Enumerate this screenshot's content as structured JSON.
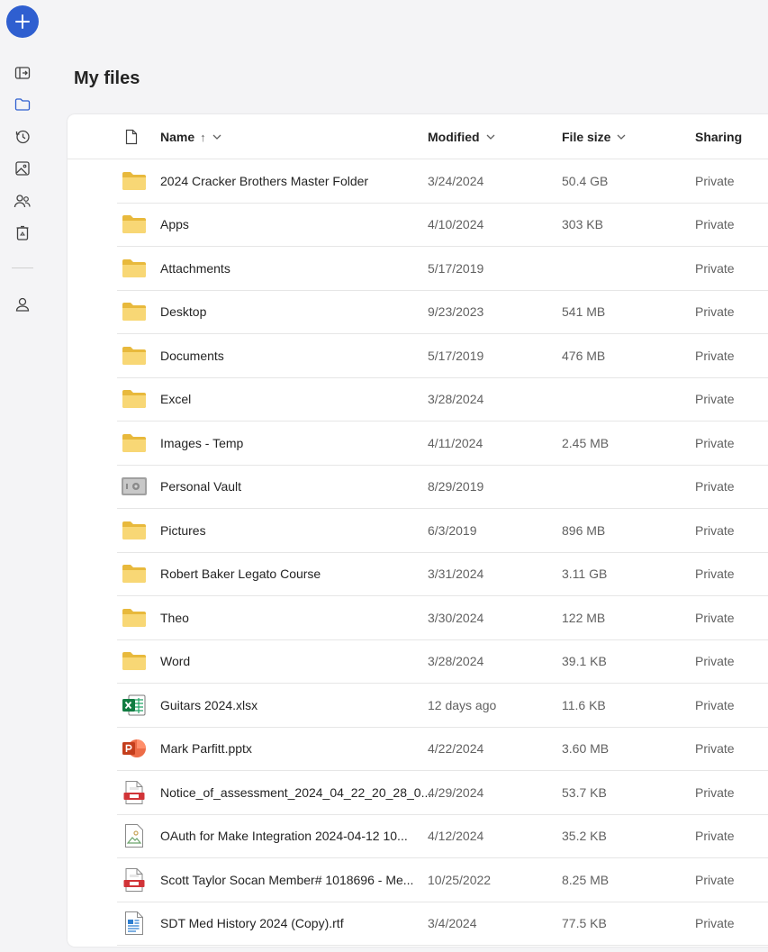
{
  "page": {
    "title": "My files"
  },
  "rail": {
    "new_label": "+",
    "icons": [
      "sidebar-toggle-icon",
      "folder-icon",
      "recent-icon",
      "photos-icon",
      "shared-icon",
      "recycle-bin-icon",
      "account-icon"
    ]
  },
  "columns": {
    "name": "Name",
    "sort_arrow": "↑",
    "modified": "Modified",
    "size": "File size",
    "sharing": "Sharing"
  },
  "files": [
    {
      "icon": "folder",
      "name": "2024 Cracker Brothers Master Folder",
      "modified": "3/24/2024",
      "size": "50.4 GB",
      "sharing": "Private"
    },
    {
      "icon": "folder",
      "name": "Apps",
      "modified": "4/10/2024",
      "size": "303 KB",
      "sharing": "Private"
    },
    {
      "icon": "folder",
      "name": "Attachments",
      "modified": "5/17/2019",
      "size": "",
      "sharing": "Private"
    },
    {
      "icon": "folder",
      "name": "Desktop",
      "modified": "9/23/2023",
      "size": "541 MB",
      "sharing": "Private"
    },
    {
      "icon": "folder",
      "name": "Documents",
      "modified": "5/17/2019",
      "size": "476 MB",
      "sharing": "Private"
    },
    {
      "icon": "folder",
      "name": "Excel",
      "modified": "3/28/2024",
      "size": "",
      "sharing": "Private"
    },
    {
      "icon": "folder",
      "name": "Images - Temp",
      "modified": "4/11/2024",
      "size": "2.45 MB",
      "sharing": "Private"
    },
    {
      "icon": "vault",
      "name": "Personal Vault",
      "modified": "8/29/2019",
      "size": "",
      "sharing": "Private"
    },
    {
      "icon": "folder",
      "name": "Pictures",
      "modified": "6/3/2019",
      "size": "896 MB",
      "sharing": "Private"
    },
    {
      "icon": "folder",
      "name": "Robert Baker Legato Course",
      "modified": "3/31/2024",
      "size": "3.11 GB",
      "sharing": "Private"
    },
    {
      "icon": "folder",
      "name": "Theo",
      "modified": "3/30/2024",
      "size": "122 MB",
      "sharing": "Private"
    },
    {
      "icon": "folder",
      "name": "Word",
      "modified": "3/28/2024",
      "size": "39.1 KB",
      "sharing": "Private"
    },
    {
      "icon": "excel",
      "name": "Guitars 2024.xlsx",
      "modified": "12 days ago",
      "size": "11.6 KB",
      "sharing": "Private"
    },
    {
      "icon": "powerpoint",
      "name": "Mark Parfitt.pptx",
      "modified": "4/22/2024",
      "size": "3.60 MB",
      "sharing": "Private"
    },
    {
      "icon": "pdf",
      "name": "Notice_of_assessment_2024_04_22_20_28_0...",
      "modified": "4/29/2024",
      "size": "53.7 KB",
      "sharing": "Private"
    },
    {
      "icon": "image",
      "name": "OAuth for Make Integration 2024-04-12 10...",
      "modified": "4/12/2024",
      "size": "35.2 KB",
      "sharing": "Private"
    },
    {
      "icon": "pdf",
      "name": "Scott Taylor Socan Member# 1018696 - Me...",
      "modified": "10/25/2022",
      "size": "8.25 MB",
      "sharing": "Private"
    },
    {
      "icon": "rtf",
      "name": "SDT Med History 2024 (Copy).rtf",
      "modified": "3/4/2024",
      "size": "77.5 KB",
      "sharing": "Private"
    }
  ],
  "colors": {
    "accent": "#2f5fd0",
    "folder": "#f8d775",
    "excel": "#107c41",
    "powerpoint": "#c43e1c",
    "pdf": "#d13438"
  }
}
